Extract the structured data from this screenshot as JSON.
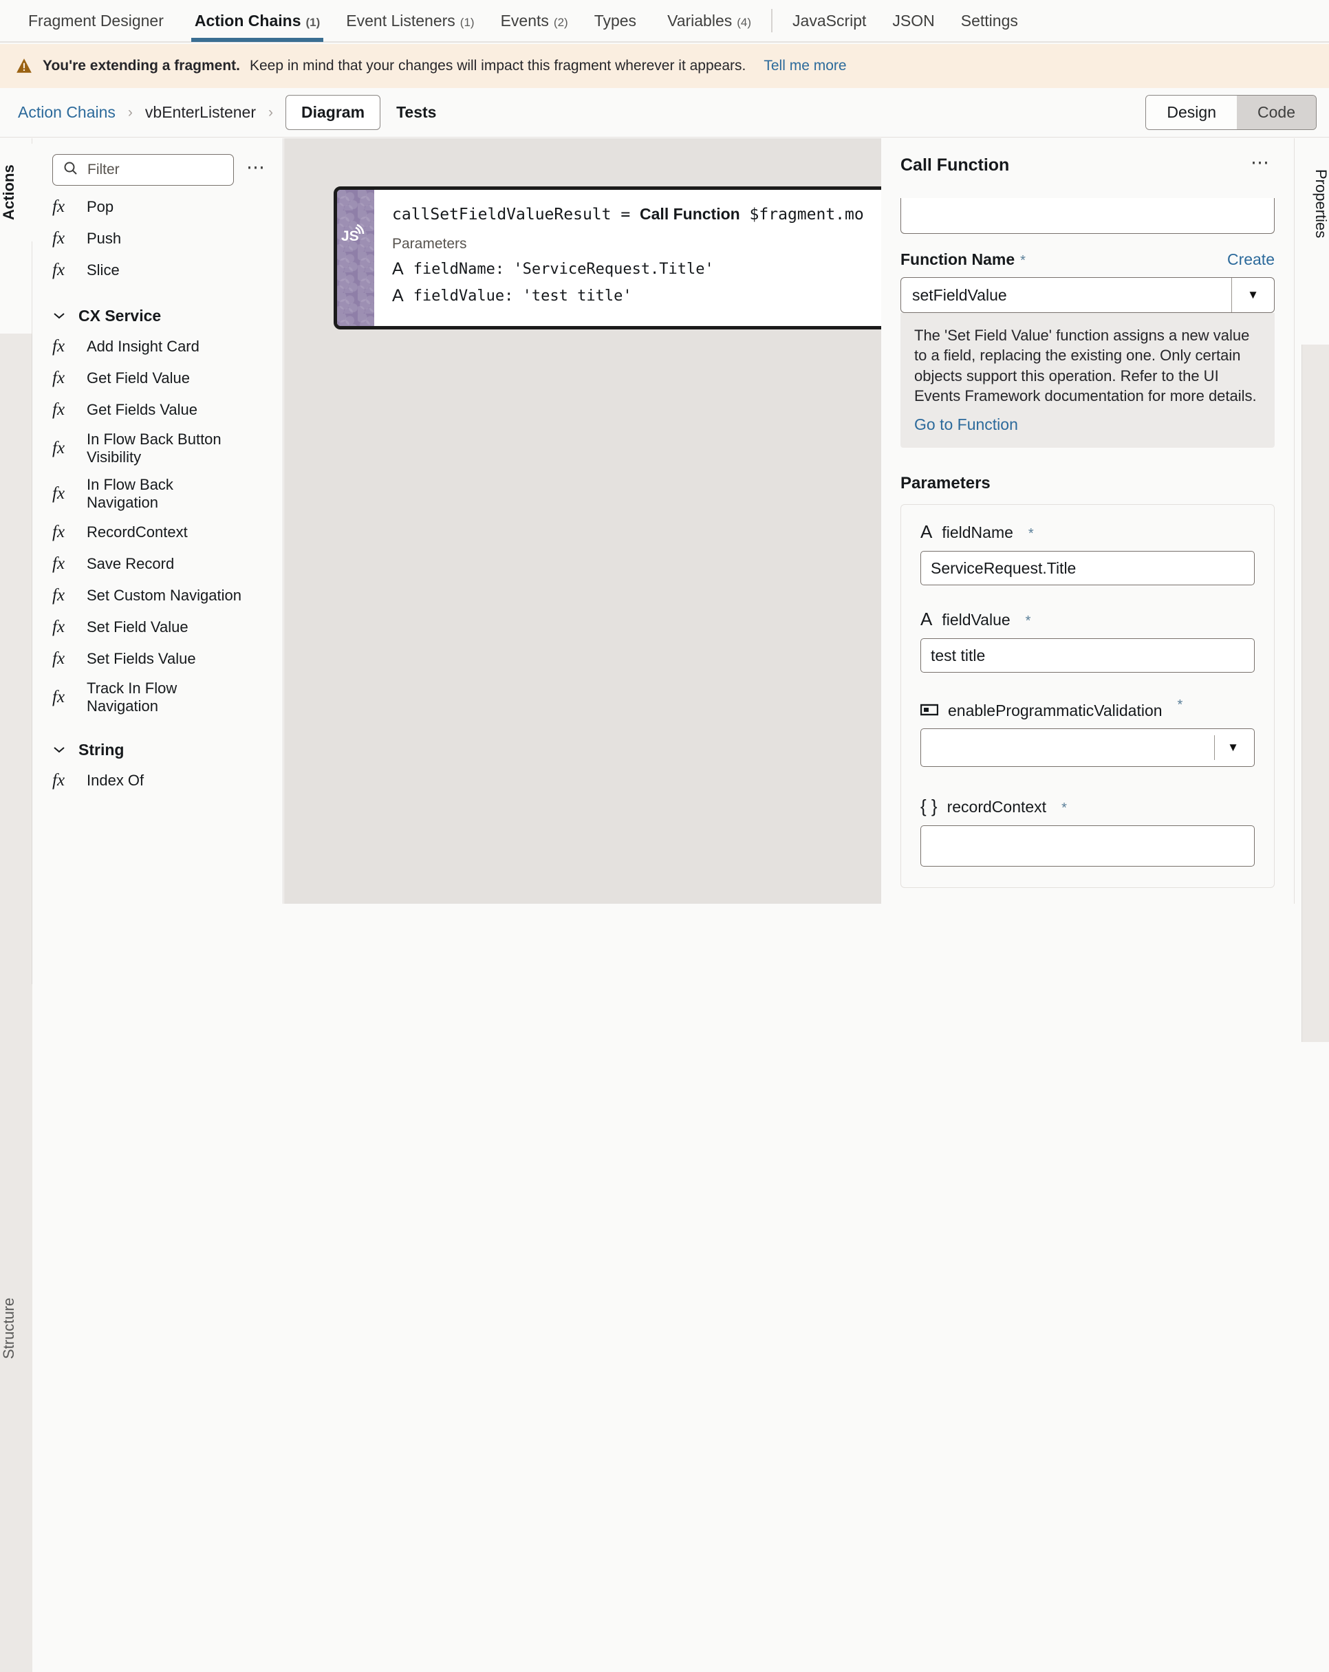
{
  "tabs": [
    {
      "label": "Fragment Designer",
      "count": "",
      "active": false
    },
    {
      "label": "Action Chains",
      "count": "(1)",
      "active": true
    },
    {
      "label": "Event Listeners",
      "count": "(1)",
      "active": false
    },
    {
      "label": "Events",
      "count": "(2)",
      "active": false
    },
    {
      "label": "Types",
      "count": "",
      "active": false
    },
    {
      "label": "Variables",
      "count": "(4)",
      "active": false
    },
    {
      "label": "JavaScript",
      "count": "",
      "active": false,
      "after_sep": true
    },
    {
      "label": "JSON",
      "count": "",
      "active": false
    },
    {
      "label": "Settings",
      "count": "",
      "active": false
    }
  ],
  "banner": {
    "icon": "warning-icon",
    "bold_text": "You're extending a fragment.",
    "message": "Keep in mind that your changes will impact this fragment wherever it appears.",
    "link": "Tell me more",
    "bg": "#faeee0"
  },
  "breadcrumb": {
    "root": "Action Chains",
    "separator": "›",
    "current": "vbEnterListener",
    "segments": [
      {
        "label": "Diagram",
        "selected": true
      },
      {
        "label": "Tests",
        "selected": false
      }
    ],
    "view_toggle": [
      {
        "label": "Design",
        "on": false
      },
      {
        "label": "Code",
        "on": true
      }
    ]
  },
  "left_rail": {
    "active_tab": "Actions",
    "inactive_tab": "Structure"
  },
  "actions_panel": {
    "filter_placeholder": "Filter",
    "search_icon": "search-icon",
    "overflow_icon": "overflow-menu-icon",
    "items": [
      {
        "type": "action",
        "label": "Pop"
      },
      {
        "type": "action",
        "label": "Push"
      },
      {
        "type": "action",
        "label": "Slice"
      },
      {
        "type": "group",
        "label": "CX Service",
        "expanded": true
      },
      {
        "type": "action",
        "label": "Add Insight Card"
      },
      {
        "type": "action",
        "label": "Get Field Value"
      },
      {
        "type": "action",
        "label": "Get Fields Value"
      },
      {
        "type": "action",
        "label": "In Flow Back Button Visibility"
      },
      {
        "type": "action",
        "label": "In Flow Back Navigation"
      },
      {
        "type": "action",
        "label": "RecordContext"
      },
      {
        "type": "action",
        "label": "Save Record"
      },
      {
        "type": "action",
        "label": "Set Custom Navigation"
      },
      {
        "type": "action",
        "label": "Set Field Value"
      },
      {
        "type": "action",
        "label": "Set Fields Value"
      },
      {
        "type": "action",
        "label": "Track In Flow Navigation"
      },
      {
        "type": "group",
        "label": "String",
        "expanded": true
      },
      {
        "type": "action",
        "label": "Index Of"
      }
    ]
  },
  "canvas": {
    "node": {
      "icon": "js-icon",
      "icon_label": "JS",
      "assignment": "callSetFieldValueResult = ",
      "action_name": "Call Function",
      "target": " $fragment.mo",
      "params_label": "Parameters",
      "params": [
        {
          "type_icon": "string-type-icon",
          "text": "fieldName: 'ServiceRequest.Title'"
        },
        {
          "type_icon": "string-type-icon",
          "text": "fieldValue: 'test title'"
        }
      ]
    }
  },
  "properties": {
    "title": "Call Function",
    "overflow_icon": "overflow-menu-icon",
    "function_name": {
      "label": "Function Name",
      "required": "*",
      "create_link": "Create",
      "value": "setFieldValue",
      "dropdown_icon": "chevron-down-icon"
    },
    "help": {
      "text": "The 'Set Field Value' function assigns a new value to a field, replacing the existing one. Only certain objects support this operation. Refer to the UI Events Framework documentation for more details.",
      "link": "Go to Function"
    },
    "parameters_label": "Parameters",
    "parameters": [
      {
        "type_icon": "string-type-icon",
        "glyph": "A",
        "name": "fieldName",
        "required": "*",
        "control": "text",
        "value": "ServiceRequest.Title"
      },
      {
        "type_icon": "string-type-icon",
        "glyph": "A",
        "name": "fieldValue",
        "required": "*",
        "control": "text",
        "value": "test title"
      },
      {
        "type_icon": "boolean-type-icon",
        "glyph": "▣",
        "name": "enableProgrammaticValidation",
        "required": "*",
        "control": "select",
        "value": ""
      },
      {
        "type_icon": "object-type-icon",
        "glyph": "{ }",
        "name": "recordContext",
        "required": "*",
        "control": "textarea",
        "value": ""
      }
    ]
  },
  "right_rail": {
    "tab": "Properties"
  },
  "colors": {
    "accent": "#3a6e92",
    "link": "#2c6a9b",
    "canvas_bg": "#e4e1de",
    "panel_bg": "#fafaf9",
    "banner_bg": "#faeee0",
    "node_strip": "#8f7fa8",
    "required_marker": "#5a7f99"
  }
}
